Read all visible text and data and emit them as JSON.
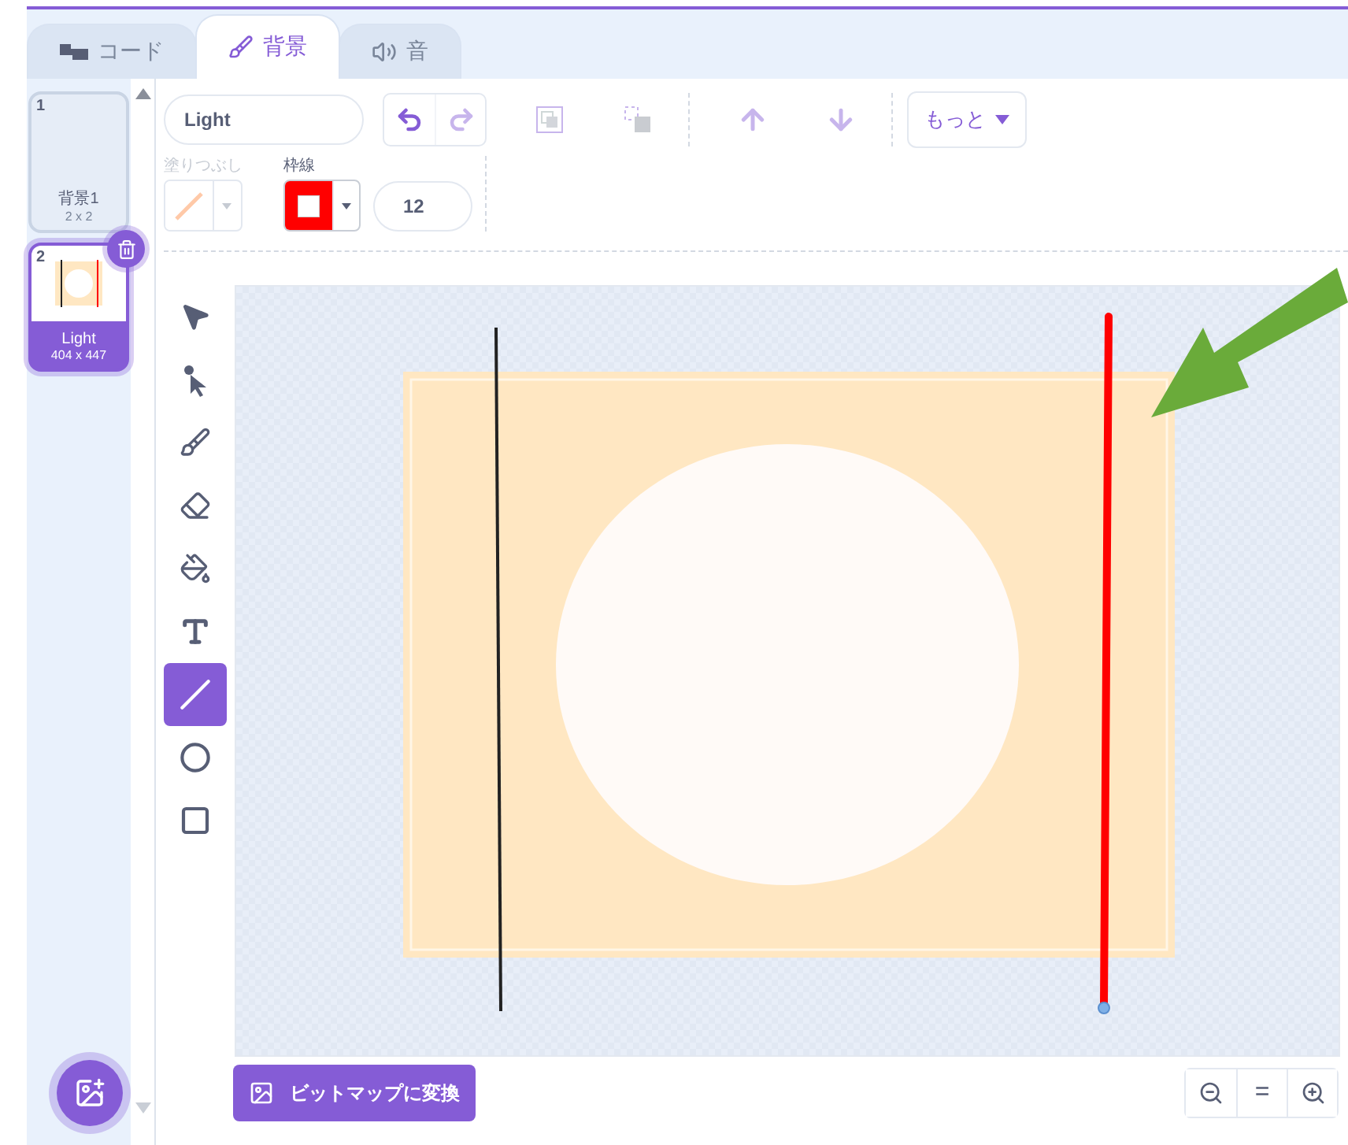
{
  "tabs": [
    {
      "kind": "code",
      "label": "コード",
      "selected": false
    },
    {
      "kind": "costumes",
      "label": "背景",
      "selected": true
    },
    {
      "kind": "sounds",
      "label": "音",
      "selected": false
    }
  ],
  "costumes": [
    {
      "number": "1",
      "name": "背景1",
      "size": "2 x 2",
      "selected": false
    },
    {
      "number": "2",
      "name": "Light",
      "size": "404 x 447",
      "selected": true
    }
  ],
  "name_field": {
    "value": "Light"
  },
  "actions": [
    {
      "kind": "undo",
      "disabled": false
    },
    {
      "kind": "redo",
      "disabled": true
    },
    {
      "kind": "group",
      "disabled": true
    },
    {
      "kind": "ungroup",
      "disabled": true
    },
    {
      "kind": "forward",
      "disabled": true
    },
    {
      "kind": "backward",
      "disabled": true
    }
  ],
  "more_button": {
    "label": "もっと"
  },
  "fill": {
    "label": "塗りつぶし",
    "disabled": true
  },
  "outline": {
    "label": "枠線"
  },
  "stroke_width": {
    "value": "12"
  },
  "tools": [
    {
      "kind": "select",
      "selected": false
    },
    {
      "kind": "reshape",
      "selected": false
    },
    {
      "kind": "brush",
      "selected": false
    },
    {
      "kind": "eraser",
      "selected": false
    },
    {
      "kind": "fill",
      "selected": false
    },
    {
      "kind": "text",
      "selected": false
    },
    {
      "kind": "line",
      "selected": true
    },
    {
      "kind": "circle",
      "selected": false
    },
    {
      "kind": "rectangle",
      "selected": false
    }
  ],
  "convert_button": {
    "label": "ビットマップに変換"
  },
  "zoom": [
    {
      "kind": "zoom-out"
    },
    {
      "kind": "reset",
      "label": "="
    },
    {
      "kind": "zoom-in"
    }
  ]
}
